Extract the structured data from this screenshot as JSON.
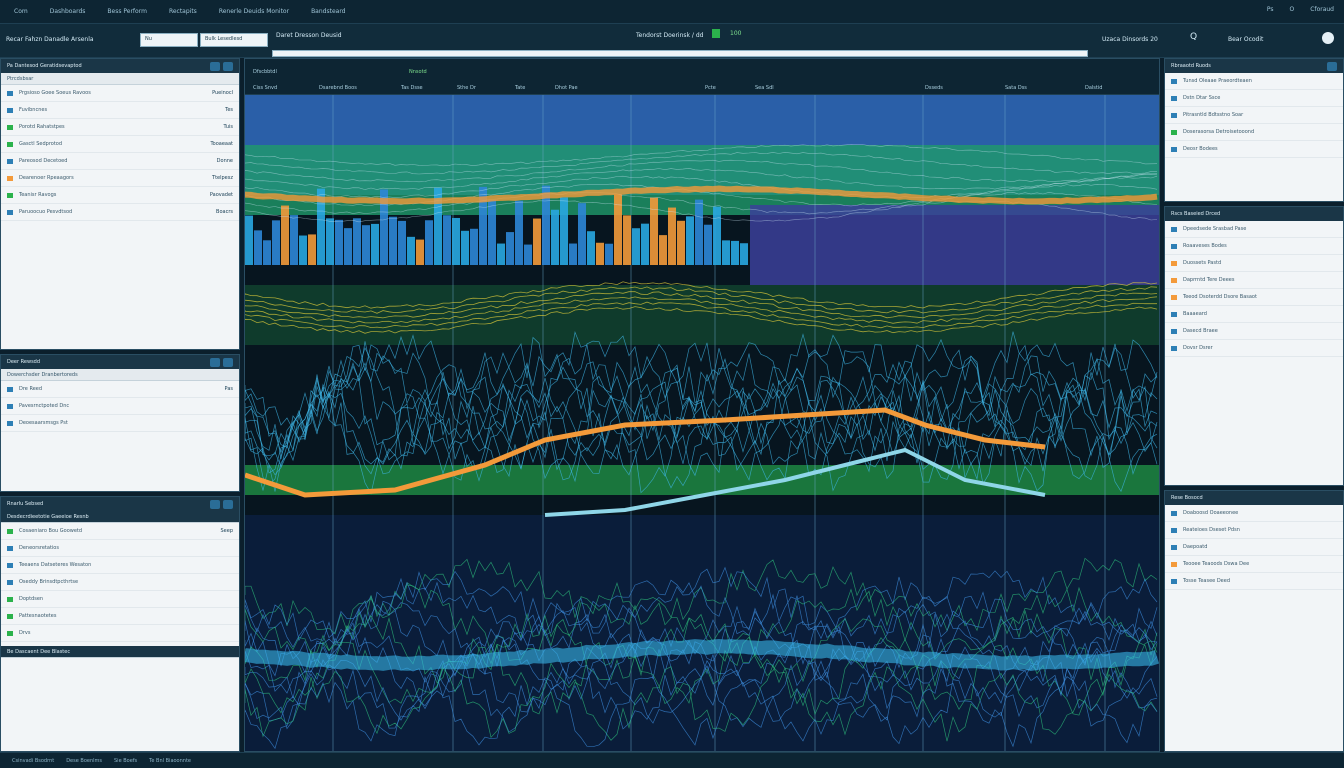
{
  "topbar": {
    "menu": [
      "Com",
      "Dashboards",
      "Bess Perform",
      "Rectapits",
      "Renerle Deuids Monitor",
      "Bandsteard"
    ],
    "right": [
      "Ps",
      "O",
      "Cforaud"
    ]
  },
  "toolbar": {
    "workspace": "Recar Fahzn Danadle Arsenla",
    "search_value": "Nu",
    "filter_value": "Bulk Lesedlesd",
    "title": "Daret Dresson Deusid",
    "center_label": "Tendorst Doerinsk / dd",
    "status_value": "100",
    "right_label": "Uzaca Dinsords 20",
    "right_icon": "Q",
    "right_text": "Bear Ocodit"
  },
  "left_panels": [
    {
      "title": "Pa Dantesod Geratidsevaptod",
      "subhead": "Ptrcdsbsar",
      "rows": [
        {
          "label": "Prgsioso Goee Soeus Ravoos",
          "value": "Pueinocl",
          "mark": "blue"
        },
        {
          "label": "Fuvibncnes",
          "value": "Tes",
          "mark": "blue"
        },
        {
          "label": "Porotd Rahatstpes",
          "value": "Tuis",
          "mark": "green"
        },
        {
          "label": "Gasctl Sedprotod",
          "value": "Tooaeaat",
          "mark": "green"
        },
        {
          "label": "Pareosod Decetoed",
          "value": "Donne",
          "mark": "blue"
        },
        {
          "label": "Dearenoer Rpeaagors",
          "value": "Ttelpesz",
          "mark": "orange"
        },
        {
          "label": "Teanisr Ravogs",
          "value": "Paovadet",
          "mark": "green"
        },
        {
          "label": "Paruoocuo Pesvdtsod",
          "value": "Boacrs",
          "mark": "blue"
        }
      ]
    },
    {
      "title": "Deer Rewsdd",
      "subhead": "Dowerchsder Dranbertoreds",
      "rows": [
        {
          "label": "Dre Reed",
          "value": "Pas",
          "mark": "blue"
        },
        {
          "label": "Pavesrnctpoted Dnc",
          "value": "",
          "mark": "blue"
        },
        {
          "label": "Deoesaarsmsgs Pst",
          "value": "",
          "mark": "blue"
        }
      ]
    },
    {
      "title": "Rnarlu Sebsed",
      "subhead": "Desdecrdieetotie Gaeeioe Resnb",
      "rows": [
        {
          "label": "Cosaeniaro Bou Goowetd",
          "value": "Seep",
          "mark": "green"
        },
        {
          "label": "Deneorsretatios",
          "value": "",
          "mark": "blue"
        },
        {
          "label": "Teeaens Datseteres Wesaton",
          "value": "",
          "mark": "blue"
        },
        {
          "label": "Oseddy Brinsdtpcthrtse",
          "value": "",
          "mark": "blue"
        },
        {
          "label": "Doptdsen",
          "value": "",
          "mark": "green"
        },
        {
          "label": "Pattesnaotetes",
          "value": "",
          "mark": "green"
        },
        {
          "label": "Drvs",
          "value": "",
          "mark": "green"
        }
      ],
      "footer": "Be Dascaent Dee Blastec"
    }
  ],
  "chart": {
    "tabs": [
      "Ciss Snvd",
      "Dsarebnd Boos",
      "Tas Dsse",
      "Sthe Dr",
      "Tate",
      "Dhot Pae",
      "Pcte",
      "Sea Sdl",
      "Dsseds",
      "Sata Dss",
      "Dalstid"
    ],
    "header_label": "Dfscbbtdl",
    "header_tag": "Nnsotd"
  },
  "right_panels": [
    {
      "title": "Rbraaotd Ruods",
      "rows": [
        {
          "label": "Tunsd Oleaae Praeordteaen",
          "mark": "blue"
        },
        {
          "label": "Dstn Dtar Ssce",
          "mark": "blue"
        },
        {
          "label": "Pitrasntld Bdtsstno Soar",
          "mark": "blue"
        },
        {
          "label": "Doserasorsa Detroisetooond",
          "mark": "green"
        },
        {
          "label": "Deosr Bodees",
          "mark": "blue"
        }
      ]
    },
    {
      "title": "Rscs Baseied Drced",
      "rows": [
        {
          "label": "Dpeedsede Srasbad Pase",
          "mark": "blue"
        },
        {
          "label": "Roaaveses Bodes",
          "mark": "blue"
        },
        {
          "label": "Duossets Pastd",
          "mark": "orange"
        },
        {
          "label": "Daprrntd Tere Deees",
          "mark": "orange"
        },
        {
          "label": "Teeod Dsoterdd Dsore Basaot",
          "mark": "orange"
        },
        {
          "label": "Baaaeard",
          "mark": "blue"
        },
        {
          "label": "Dasecd Braee",
          "mark": "blue"
        },
        {
          "label": "Dovsr Dsrer",
          "mark": "blue"
        }
      ]
    },
    {
      "title": "Rese Bosocd",
      "rows": [
        {
          "label": "Doaboosd Ooaeeonee",
          "mark": "blue"
        },
        {
          "label": "Reateioes Dseset Pdsn",
          "mark": "blue"
        },
        {
          "label": "Daepoatd",
          "mark": "blue"
        },
        {
          "label": "Teooee Teaoods Dswa Dee",
          "mark": "orange"
        },
        {
          "label": "Tosse Teasee Deed",
          "mark": "blue"
        }
      ]
    }
  ],
  "status": [
    "Csinvadi Bsodrnt",
    "Dese Boenlms",
    "Sie Boefs",
    "Te Bnl Biaoonnte"
  ]
}
